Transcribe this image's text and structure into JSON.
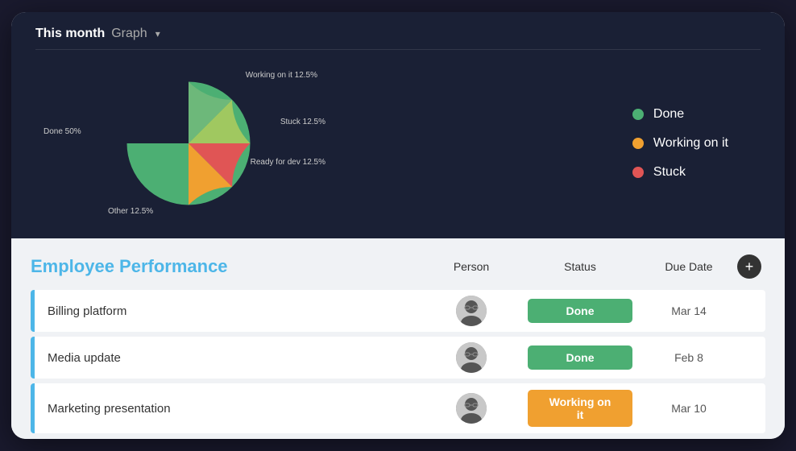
{
  "header": {
    "title_bold": "This month",
    "title_normal": "Graph",
    "dropdown_arrow": "▾"
  },
  "chart": {
    "legend": [
      {
        "label": "Done",
        "color": "#4caf73"
      },
      {
        "label": "Working on it",
        "color": "#f0a030"
      },
      {
        "label": "Stuck",
        "color": "#e05555"
      }
    ],
    "labels": {
      "working_on_it": "Working on it 12.5%",
      "stuck": "Stuck 12.5%",
      "ready_for_dev": "Ready for dev 12.5%",
      "other": "Other 12.5%",
      "done": "Done 50%"
    }
  },
  "table": {
    "title": "Employee Performance",
    "columns": {
      "person": "Person",
      "status": "Status",
      "due_date": "Due Date"
    },
    "rows": [
      {
        "name": "Billing platform",
        "status": "Done",
        "status_type": "done",
        "due_date": "Mar 14"
      },
      {
        "name": "Media update",
        "status": "Done",
        "status_type": "done",
        "due_date": "Feb 8"
      },
      {
        "name": "Marketing presentation",
        "status": "Working on it",
        "status_type": "working",
        "due_date": "Mar 10"
      }
    ]
  },
  "colors": {
    "accent_blue": "#4db6e8",
    "done_green": "#4caf73",
    "working_orange": "#f0a030",
    "stuck_red": "#e05555",
    "other_green": "#a8d060"
  }
}
